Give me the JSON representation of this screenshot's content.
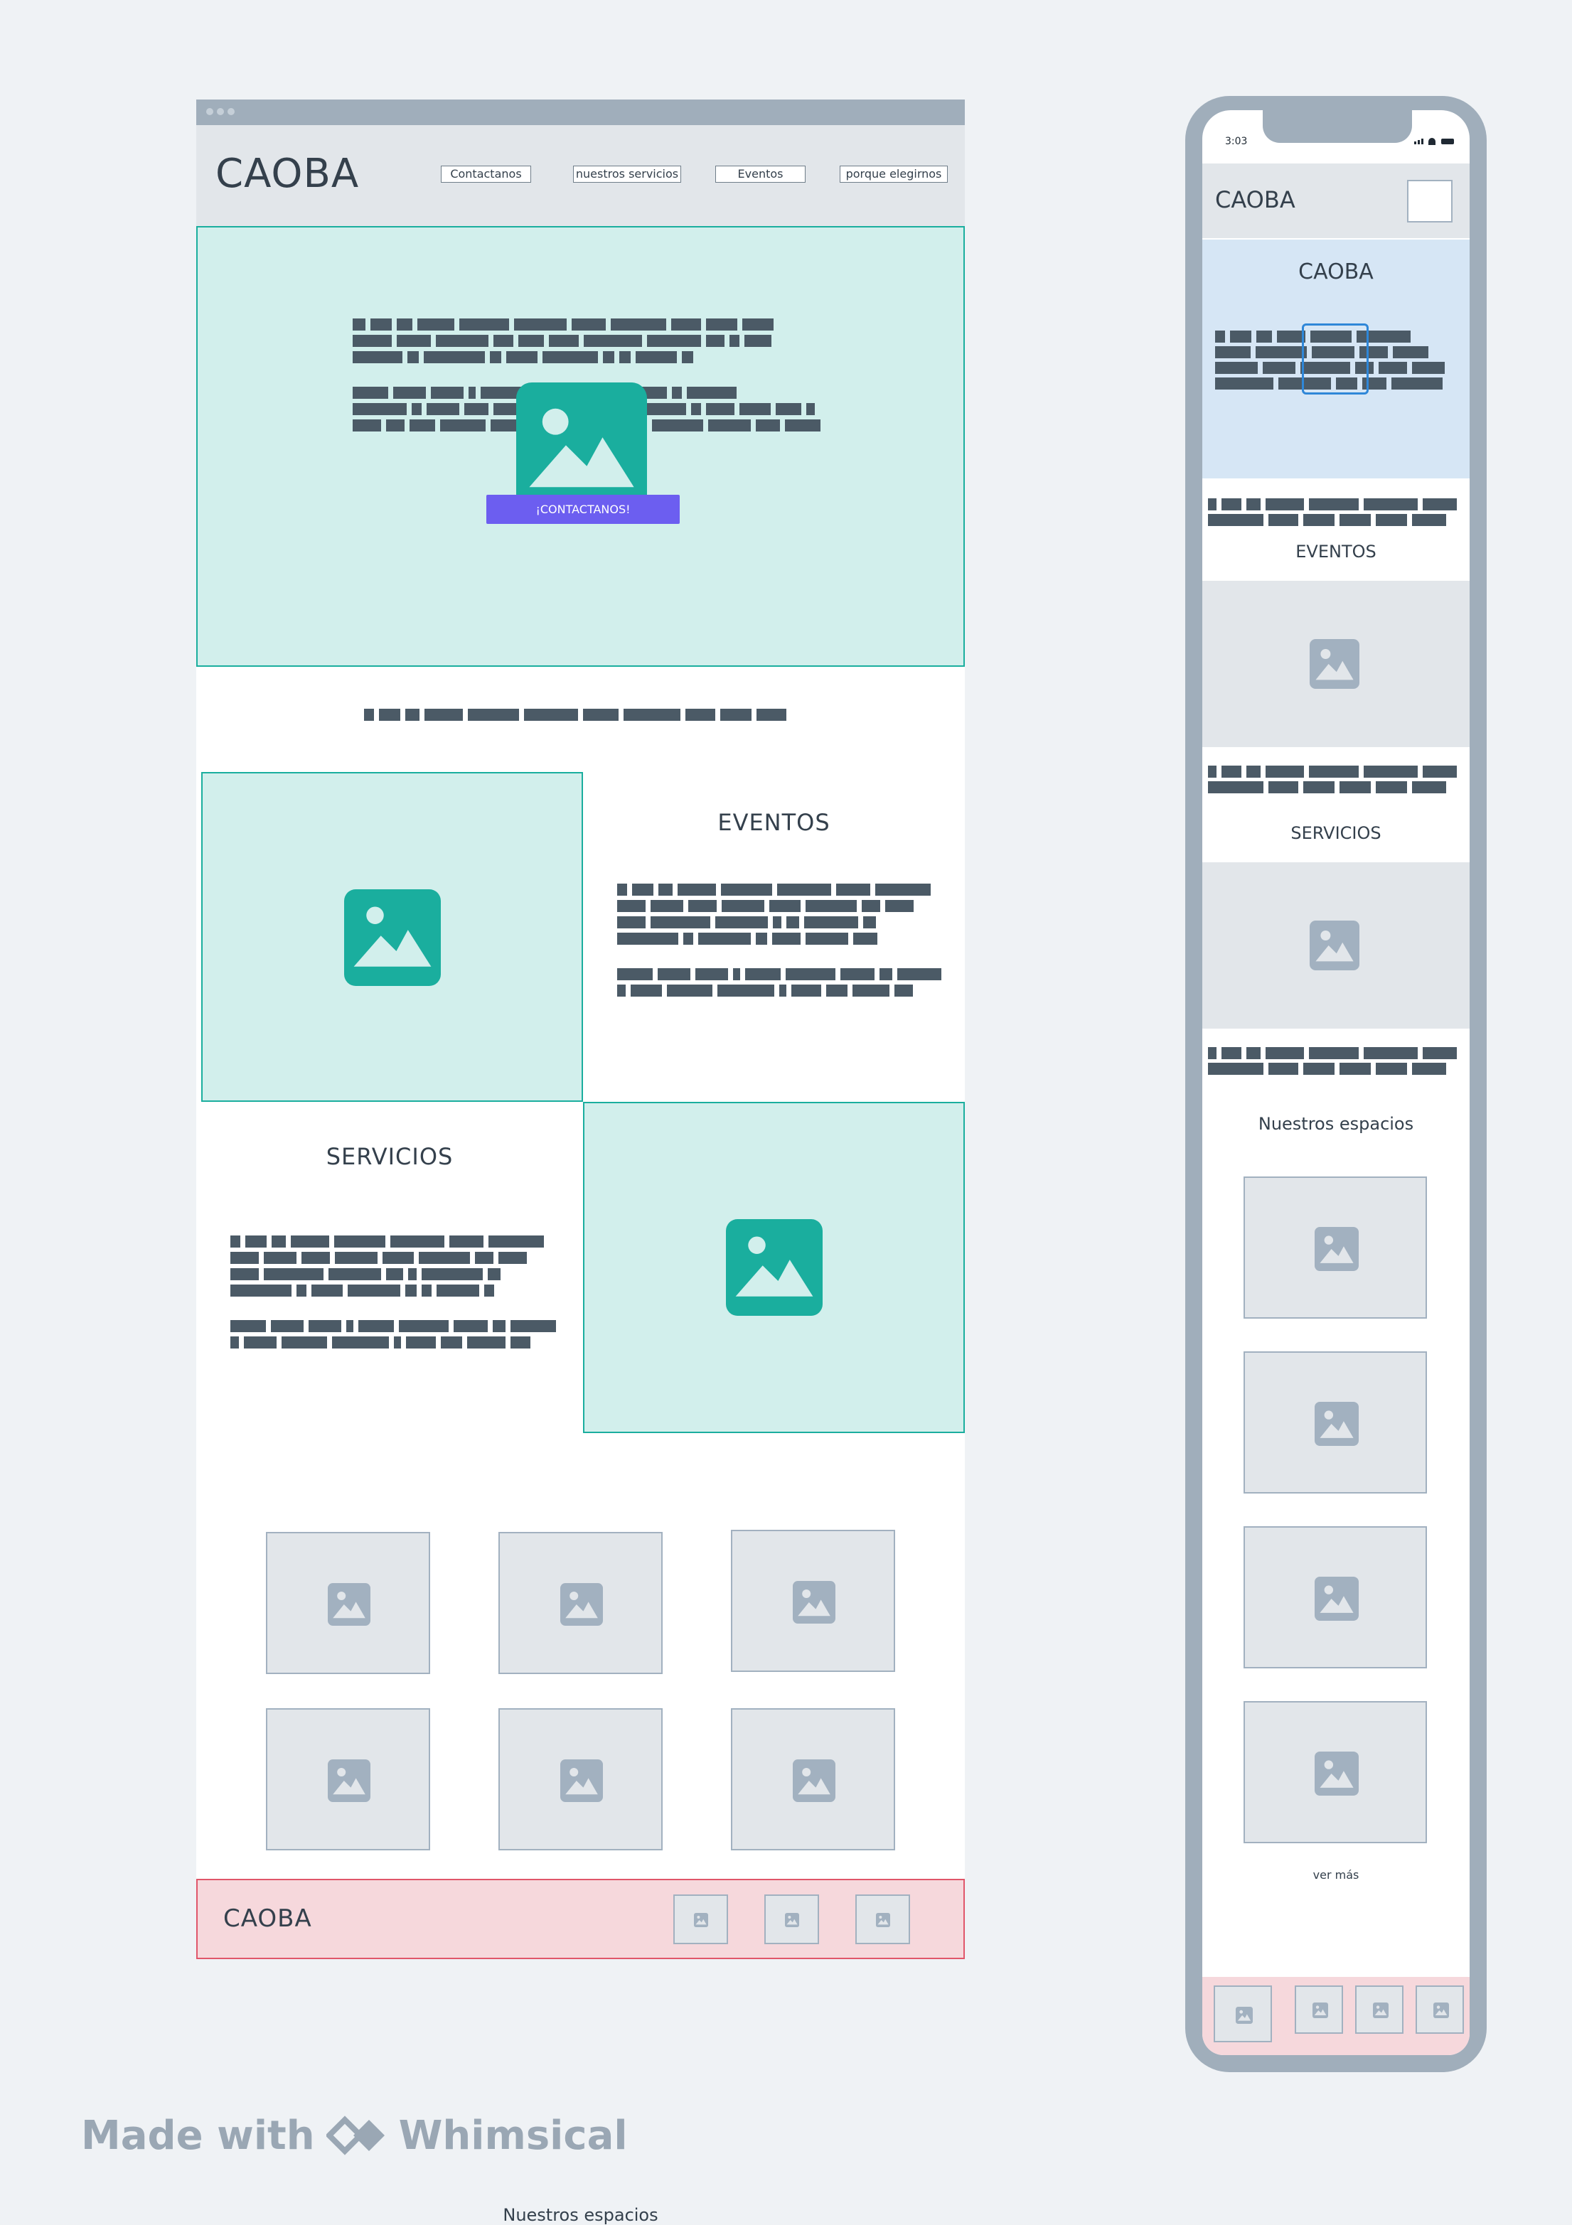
{
  "desktop": {
    "header": {
      "logo": "CAOBA",
      "nav": [
        "Contactanos",
        "nuestros servicios",
        "Eventos",
        "porque elegirnos"
      ]
    },
    "hero": {
      "cta_label": "¡CONTACTANOS!"
    },
    "eventos": {
      "title": "EVENTOS"
    },
    "servicios": {
      "title": "SERVICIOS"
    },
    "espacios": {
      "title": "Nuestros espacios"
    },
    "footer": {
      "logo": "CAOBA"
    }
  },
  "mobile": {
    "status": {
      "time": "3:03"
    },
    "header": {
      "logo": "CAOBA"
    },
    "hero": {
      "title": "CAOBA"
    },
    "eventos": {
      "title": "EVENTOS"
    },
    "servicios": {
      "title": "SERVICIOS"
    },
    "espacios": {
      "title": "Nuestros espacios",
      "more_label": "ver más"
    }
  },
  "branding": {
    "made_with": "Made with",
    "brand": "Whimsical"
  },
  "colors": {
    "teal": "#1aae9e",
    "teal_bg": "#d2efec",
    "purple": "#6c5ef0",
    "pink_bg": "#f6d8dc",
    "light_blue_bg": "#d6e6f5",
    "gray_placeholder": "#e2e6ea"
  },
  "icons": [
    "image-icon",
    "whimsical-logo-icon"
  ]
}
